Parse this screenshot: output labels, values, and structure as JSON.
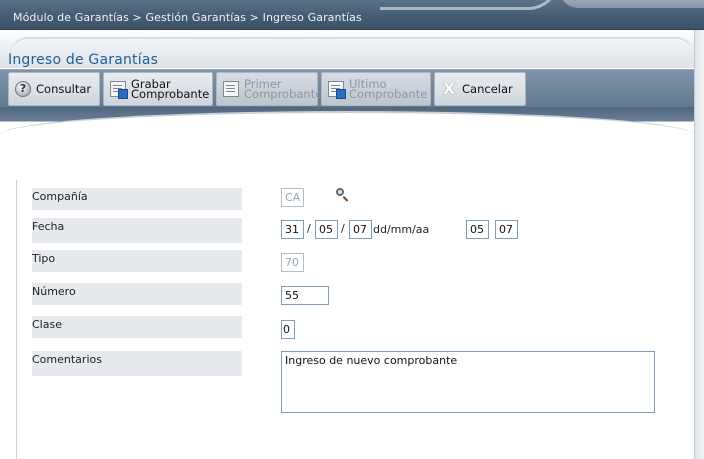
{
  "breadcrumb": "Módulo de Garantías > Gestión Garantías > Ingreso Garantías",
  "page_title": "Ingreso de Garantías",
  "toolbar": {
    "consultar": "Consultar",
    "grabar_1": "Grabar",
    "grabar_2": "Comprobante",
    "primer_1": "Primer",
    "primer_2": "Comprobante",
    "ultimo_1": "Ultimo",
    "ultimo_2": "Comprobante",
    "cancelar": "Cancelar"
  },
  "form": {
    "compania": {
      "label": "Compañía",
      "value": "CA"
    },
    "fecha": {
      "label": "Fecha",
      "day": "31",
      "month": "05",
      "year": "07",
      "format": "dd/mm/aa",
      "sep": "/",
      "hour": "05",
      "minute": "07"
    },
    "tipo": {
      "label": "Tipo",
      "value": "70"
    },
    "numero": {
      "label": "Número",
      "value": "55"
    },
    "clase": {
      "label": "Clase",
      "value": "0"
    },
    "comentarios": {
      "label": "Comentarios",
      "value": "Ingreso de nuevo comprobante"
    }
  },
  "icons": {
    "help": "question-circle-icon",
    "save": "document-save-icon",
    "first": "document-first-icon",
    "last": "document-last-icon",
    "cancel": "x-icon",
    "search": "magnifier-icon"
  },
  "colors": {
    "title_blue": "#1f5f9a",
    "toolbar_slate": "#62798f",
    "input_border": "#7f9db9",
    "label_bg": "#e6e9ed"
  }
}
